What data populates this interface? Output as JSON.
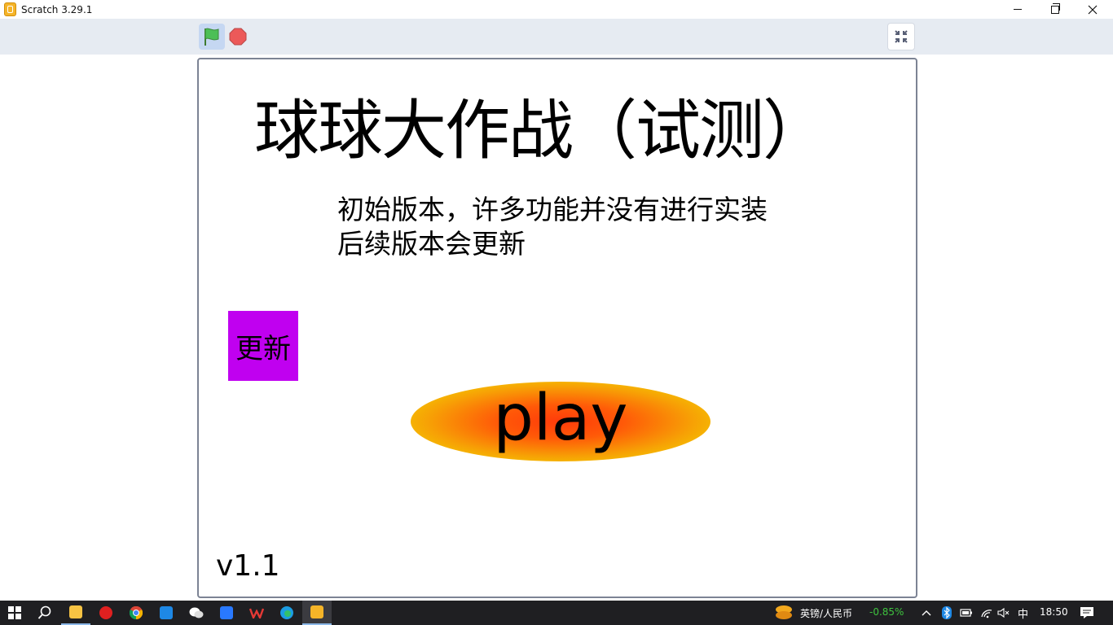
{
  "window": {
    "title": "Scratch 3.29.1"
  },
  "toolbar": {
    "green_flag": "green-flag-icon",
    "stop": "stop-icon",
    "fullscreen": "exit-fullscreen-icon"
  },
  "stage": {
    "game_title": "球球大作战（试测）",
    "description_line1": "初始版本，许多功能并没有进行实装",
    "description_line2": "后续版本会更新",
    "update_button_label": "更新",
    "play_button_label": "play",
    "version": "v1.1"
  },
  "colors": {
    "update_button": "#c000f0",
    "play_center": "#ff3b0a",
    "play_edge": "#f2ec00",
    "toolbar": "#e6ebf2",
    "stage_border": "#7c8394"
  },
  "taskbar": {
    "currency_pair": "英镑/人民币",
    "currency_change": "-0.85%",
    "ime": "中",
    "time": "18:50"
  }
}
